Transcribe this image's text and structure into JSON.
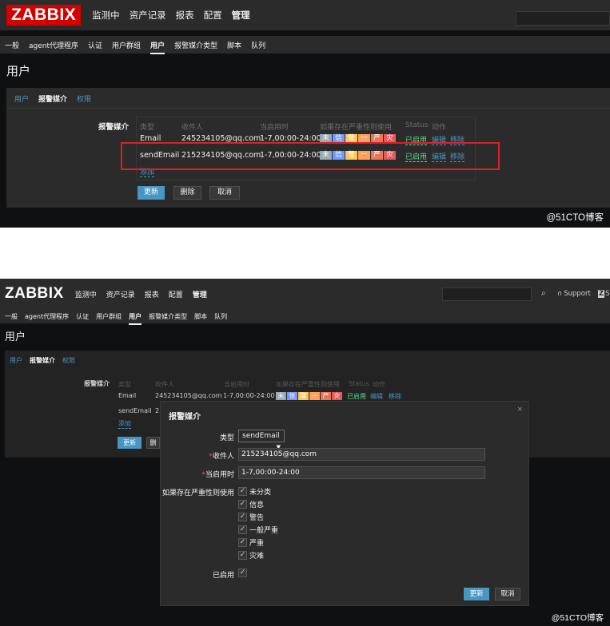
{
  "shot1": {
    "logo": "ZABBIX",
    "main_nav": [
      "监测中",
      "资产记录",
      "报表",
      "配置",
      "管理"
    ],
    "sub_nav": [
      "一般",
      "agent代理程序",
      "认证",
      "用户群组",
      "用户",
      "报警媒介类型",
      "脚本",
      "队列"
    ],
    "page_title": "用户",
    "tabs": [
      "用户",
      "报警媒介",
      "权限"
    ],
    "media_label": "报警媒介",
    "table_headers": [
      "类型",
      "收件人",
      "当启用时",
      "如果存在严重性则使用",
      "Status",
      "动作"
    ],
    "rows": [
      {
        "type": "Email",
        "recipient": "245234105@qq.com",
        "when": "1-7,00:00-24:00",
        "status": "已启用",
        "edit": "编辑",
        "remove": "移除"
      },
      {
        "type": "sendEmail",
        "recipient": "215234105@qq.com",
        "when": "1-7,00:00-24:00",
        "status": "已启用",
        "edit": "编辑",
        "remove": "移除"
      }
    ],
    "add_link": "添加",
    "btn_update": "更新",
    "btn_delete": "删除",
    "btn_cancel": "取消",
    "watermark": "@51CTO博客"
  },
  "shot2": {
    "logo": "ZABBIX",
    "main_nav": [
      "监测中",
      "资产记录",
      "报表",
      "配置",
      "管理"
    ],
    "support_label": "Support",
    "extra_label": "S",
    "sub_nav": [
      "一般",
      "agent代理程序",
      "认证",
      "用户群组",
      "用户",
      "报警媒介类型",
      "脚本",
      "队列"
    ],
    "page_title": "用户",
    "tabs": [
      "用户",
      "报警媒介",
      "权限"
    ],
    "media_label": "报警媒介",
    "table_headers": [
      "类型",
      "收件人",
      "当启用时",
      "如果存在严重性则使用",
      "Status",
      "动作"
    ],
    "rows": [
      {
        "type": "Email",
        "recipient": "245234105@qq.com",
        "when": "1-7,00:00-24:00",
        "status": "已启用",
        "edit": "编辑",
        "remove": "移除"
      },
      {
        "type": "sendEmail",
        "recipient": "21"
      }
    ],
    "add_link": "添加",
    "btn_update": "更新",
    "btn_delete_partial": "删",
    "watermark": "@51CTO博客",
    "dialog": {
      "title": "报警媒介",
      "close": "×",
      "type_label": "类型",
      "type_value": "sendEmail",
      "recipient_label": "收件人",
      "recipient_value": "215234105@qq.com",
      "when_label": "当启用时",
      "when_value": "1-7,00:00-24:00",
      "severity_label": "如果存在严重性则使用",
      "severities": [
        "未分类",
        "信息",
        "警告",
        "一般严重",
        "严重",
        "灾难"
      ],
      "enabled_label": "已启用",
      "btn_update": "更新",
      "btn_cancel": "取消"
    }
  },
  "severity_badges": {
    "labels": [
      "未",
      "信",
      "警",
      "一",
      "严",
      "灾"
    ],
    "colors": [
      "#97aab3",
      "#7499ff",
      "#ffc859",
      "#ffa059",
      "#e97659",
      "#e45959"
    ]
  },
  "colors": {
    "brand": "#d40000",
    "accent": "#4796c4",
    "enabled": "#59db8f",
    "highlight_box": "#e21f26"
  }
}
